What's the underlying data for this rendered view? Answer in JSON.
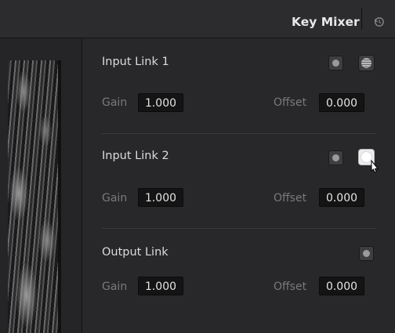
{
  "header": {
    "title": "Key Mixer",
    "reset_icon": "reset-icon"
  },
  "viewer": {
    "image": "key-preview-image"
  },
  "sections": [
    {
      "title": "Input Link 1",
      "gain_label": "Gain",
      "gain": "1.000",
      "offset_label": "Offset",
      "offset": "0.000"
    },
    {
      "title": "Input Link 2",
      "gain_label": "Gain",
      "gain": "1.000",
      "offset_label": "Offset",
      "offset": "0.000"
    },
    {
      "title": "Output Link",
      "gain_label": "Gain",
      "gain": "1.000",
      "offset_label": "Offset",
      "offset": "0.000"
    }
  ],
  "colors": {
    "header_bg": "#2c2c2f",
    "panel_bg": "#28282a",
    "field_bg": "#141415",
    "text": "#dcdcdc",
    "label": "#7a7a7d"
  }
}
